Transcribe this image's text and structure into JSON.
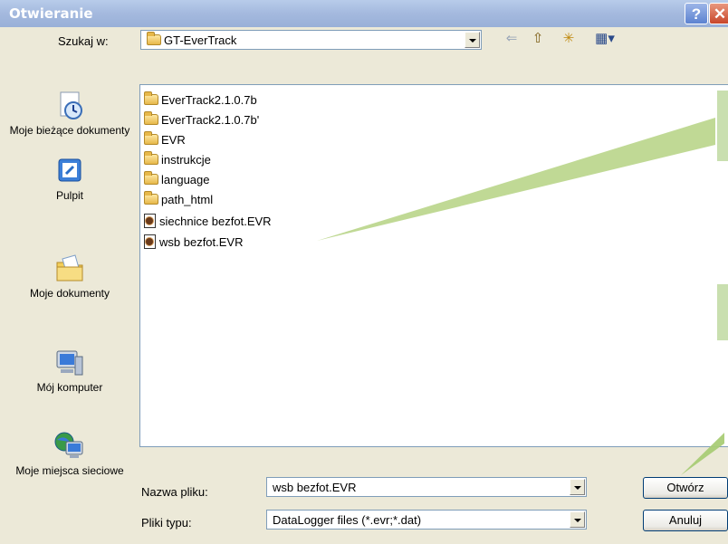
{
  "window": {
    "title": "Otwieranie",
    "help_label": "?",
    "close_label": "✕"
  },
  "lookin": {
    "label": "Szukaj w:",
    "value": "GT-EverTrack"
  },
  "toolbar": {
    "back_icon": "⇐",
    "up_icon": "⇧",
    "newfolder_icon": "✳",
    "view_icon": "▦▾"
  },
  "places": [
    {
      "label": "Moje bieżące dokumenty",
      "icon": "recent-documents-icon"
    },
    {
      "label": "Pulpit",
      "icon": "desktop-icon"
    },
    {
      "label": "Moje dokumenty",
      "icon": "my-documents-icon"
    },
    {
      "label": "Mój komputer",
      "icon": "my-computer-icon"
    },
    {
      "label": "Moje miejsca sieciowe",
      "icon": "network-places-icon"
    }
  ],
  "files": [
    {
      "name": "EverTrack2.1.0.7b",
      "type": "folder"
    },
    {
      "name": "EverTrack2.1.0.7b'",
      "type": "folder"
    },
    {
      "name": "EVR",
      "type": "folder"
    },
    {
      "name": "instrukcje",
      "type": "folder"
    },
    {
      "name": "language",
      "type": "folder"
    },
    {
      "name": "path_html",
      "type": "folder"
    },
    {
      "name": "siechnice bezfot.EVR",
      "type": "evr"
    },
    {
      "name": "wsb bezfot.EVR",
      "type": "evr"
    }
  ],
  "filename": {
    "label": "Nazwa pliku:",
    "value": "wsb bezfot.EVR"
  },
  "filetype": {
    "label": "Pliki typu:",
    "value": "DataLogger files (*.evr;*.dat)"
  },
  "buttons": {
    "open": "Otwórz",
    "cancel": "Anuluj"
  }
}
